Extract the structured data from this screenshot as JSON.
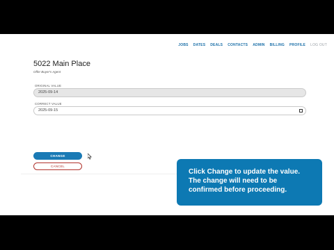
{
  "nav": {
    "items": [
      "JOBS",
      "DATES",
      "DEALS",
      "CONTACTS",
      "ADMIN",
      "BILLING",
      "PROFILE"
    ],
    "logout": "LOG OUT"
  },
  "page": {
    "title": "5022 Main Place",
    "subtitle": "Offer Buyer's Agent"
  },
  "form": {
    "original_label": "ORIGINAL VALUE",
    "original_value": "2025-09-14",
    "correct_label": "CORRECT VALUE",
    "correct_value": "2025-09-15",
    "change_label": "CHANGE",
    "cancel_label": "CANCEL"
  },
  "tooltip": {
    "text": "Click Change to update the value. The change will need to be confirmed before proceeding."
  },
  "colors": {
    "accent": "#1a7ab5",
    "danger": "#b0322c",
    "tooltip_bg": "#0d79b3"
  }
}
